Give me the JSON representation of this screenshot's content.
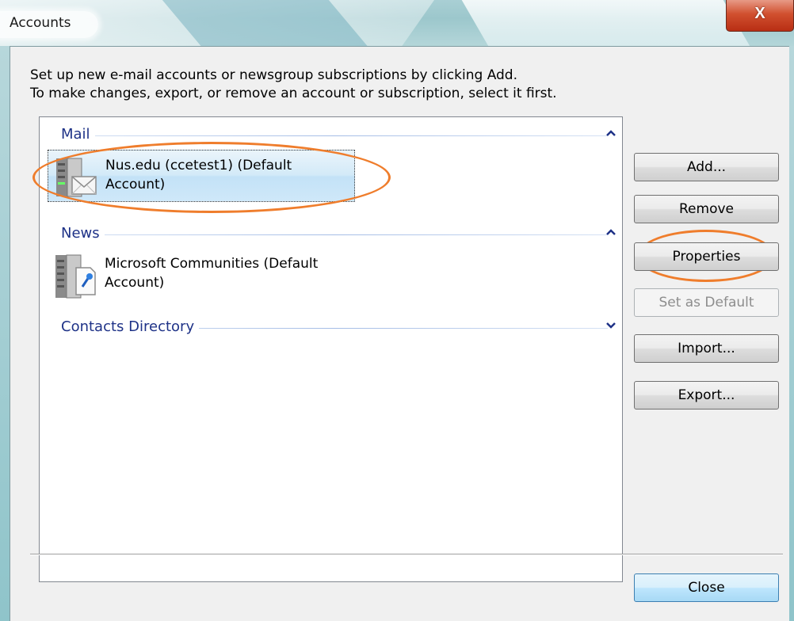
{
  "window": {
    "title": "Accounts",
    "close_glyph": "X"
  },
  "instructions": {
    "line1": "Set up new e-mail accounts or newsgroup subscriptions by clicking Add.",
    "line2": "To make changes, export, or remove an account or subscription, select it first."
  },
  "groups": {
    "mail": {
      "label": "Mail",
      "chevron": "collapse-chevron-icon"
    },
    "news": {
      "label": "News",
      "chevron": "collapse-chevron-icon"
    },
    "contacts": {
      "label": "Contacts Directory",
      "chevron": "expand-chevron-icon"
    }
  },
  "accounts": {
    "mail": {
      "label": "Nus.edu (ccetest1) (Default Account)",
      "icon": "mail-server-icon",
      "selected": true
    },
    "news": {
      "label": "Microsoft Communities (Default Account)",
      "icon": "news-server-icon",
      "selected": false
    }
  },
  "buttons": {
    "add": "Add...",
    "remove": "Remove",
    "properties": "Properties",
    "set_default": "Set as Default",
    "import": "Import...",
    "export": "Export...",
    "close": "Close"
  },
  "colors": {
    "annotation": "#ef7d2c",
    "group_header": "#1e3287",
    "selection": "#cfe8f9",
    "close_button": "#c8452a"
  }
}
